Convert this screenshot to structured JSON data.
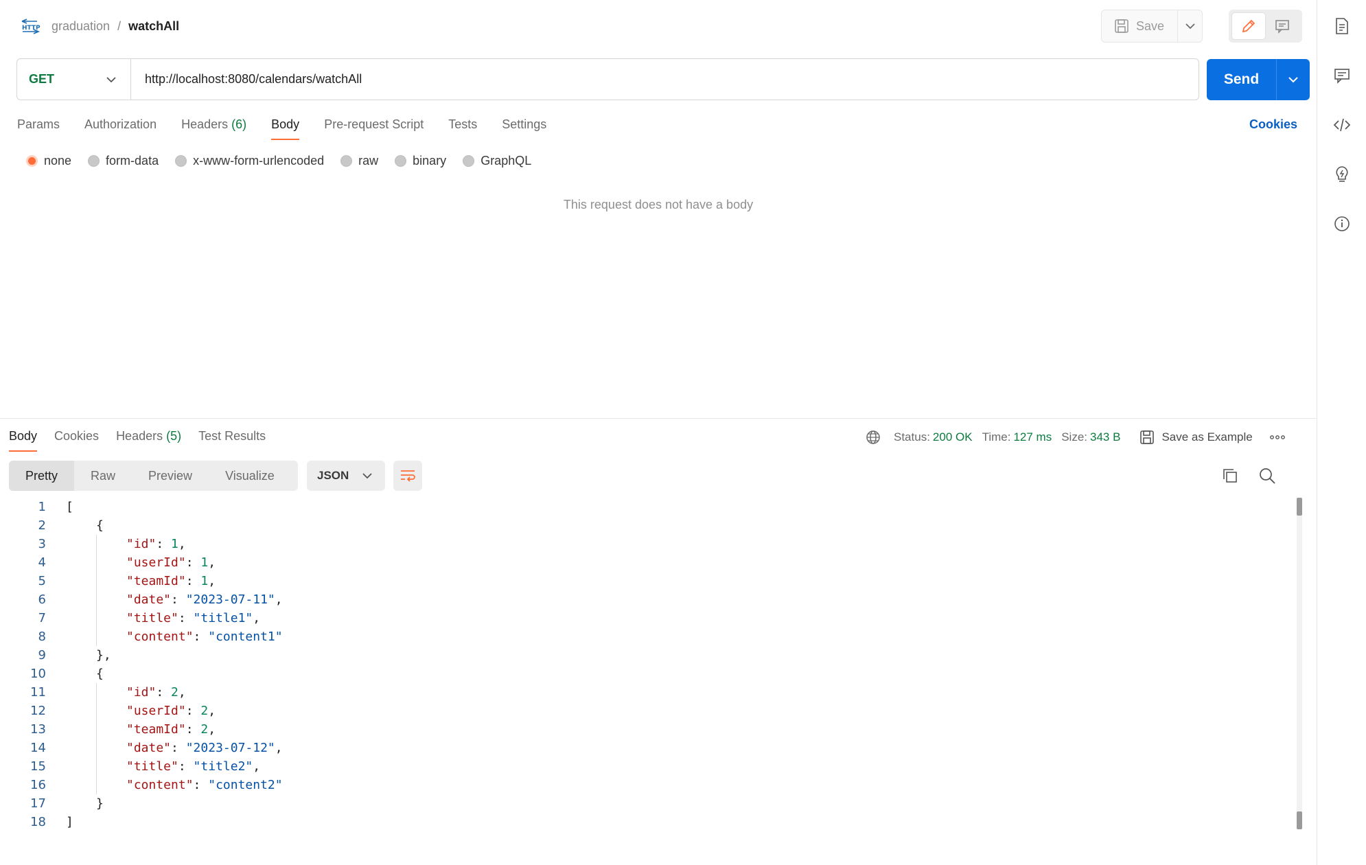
{
  "breadcrumb": {
    "collection": "graduation",
    "separator": "/",
    "request": "watchAll",
    "icon": "http-icon"
  },
  "toolbar": {
    "save_label": "Save"
  },
  "request": {
    "method": "GET",
    "url": "http://localhost:8080/calendars/watchAll",
    "send_label": "Send"
  },
  "request_tabs": [
    {
      "label": "Params"
    },
    {
      "label": "Authorization"
    },
    {
      "label": "Headers",
      "count": "(6)"
    },
    {
      "label": "Body",
      "active": true
    },
    {
      "label": "Pre-request Script"
    },
    {
      "label": "Tests"
    },
    {
      "label": "Settings"
    }
  ],
  "cookies_label": "Cookies",
  "body_modes": [
    "none",
    "form-data",
    "x-www-form-urlencoded",
    "raw",
    "binary",
    "GraphQL"
  ],
  "body_mode_selected": "none",
  "no_body_text": "This request does not have a body",
  "response": {
    "tabs": [
      {
        "label": "Body",
        "active": true
      },
      {
        "label": "Cookies"
      },
      {
        "label": "Headers",
        "count": "(5)"
      },
      {
        "label": "Test Results"
      }
    ],
    "status_label": "Status:",
    "status_value": "200 OK",
    "time_label": "Time:",
    "time_value": "127 ms",
    "size_label": "Size:",
    "size_value": "343 B",
    "save_example_label": "Save as Example",
    "format_tabs": [
      "Pretty",
      "Raw",
      "Preview",
      "Visualize"
    ],
    "format_selected": "Pretty",
    "language": "JSON",
    "code_lines": [
      "1",
      "2",
      "3",
      "4",
      "5",
      "6",
      "7",
      "8",
      "9",
      "10",
      "11",
      "12",
      "13",
      "14",
      "15",
      "16",
      "17",
      "18"
    ],
    "json": [
      {
        "id": 1,
        "userId": 1,
        "teamId": 1,
        "date": "2023-07-11",
        "title": "title1",
        "content": "content1"
      },
      {
        "id": 2,
        "userId": 2,
        "teamId": 2,
        "date": "2023-07-12",
        "title": "title2",
        "content": "content2"
      }
    ]
  },
  "colors": {
    "accent": "#ff6c37",
    "send": "#0a6fe0",
    "method_get": "#0b7b3e",
    "status_ok": "#0b7b3e",
    "link": "#0a5fc4"
  }
}
